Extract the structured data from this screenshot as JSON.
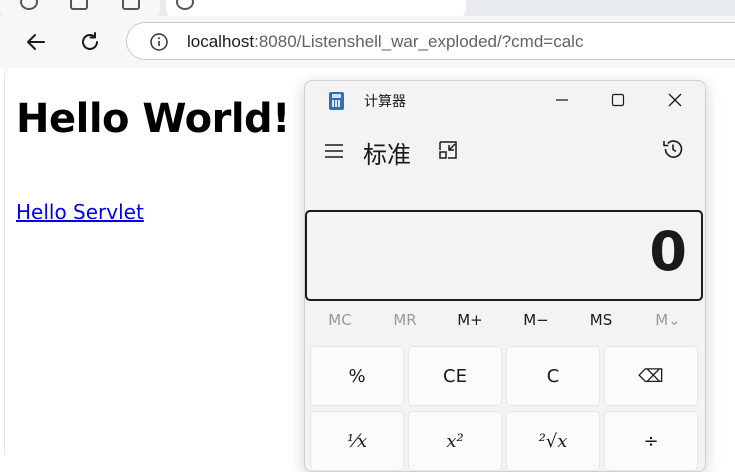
{
  "browser": {
    "address": {
      "host": "localhost",
      "rest": ":8080/Listenshell_war_exploded/?cmd=calc"
    }
  },
  "page": {
    "heading": "Hello World!",
    "link": "Hello Servlet"
  },
  "calculator": {
    "title": "计算器",
    "mode": "标准",
    "display_value": "0",
    "memory_buttons": [
      {
        "label": "MC",
        "enabled": false
      },
      {
        "label": "MR",
        "enabled": false
      },
      {
        "label": "M+",
        "enabled": true
      },
      {
        "label": "M−",
        "enabled": true
      },
      {
        "label": "MS",
        "enabled": true
      },
      {
        "label": "M⌄",
        "enabled": false
      }
    ],
    "keys_row1": [
      "%",
      "CE",
      "C",
      "⌫"
    ],
    "keys_row2": [
      "⅟x",
      "x²",
      "²√x",
      "÷"
    ]
  }
}
